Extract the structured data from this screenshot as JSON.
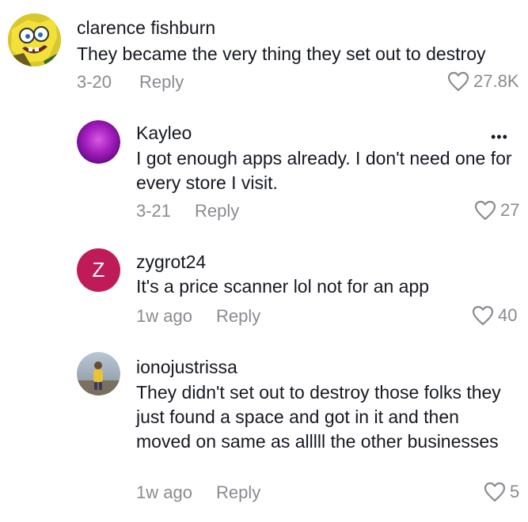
{
  "comments": [
    {
      "username": "clarence fishburn",
      "text": "They became the very thing they set out to destroy",
      "date": "3-20",
      "reply_label": "Reply",
      "likes": "27.8K",
      "avatar_icon": "spongebob-avatar"
    },
    {
      "username": "Kayleo",
      "text": "I got enough apps already. I don't need one for every store I visit.",
      "date": "3-21",
      "reply_label": "Reply",
      "likes": "27",
      "avatar_icon": "purple-gradient-avatar",
      "more_label": "•••"
    },
    {
      "username": "zygrot24",
      "text": "It's a price scanner lol not for an app",
      "date": "1w ago",
      "reply_label": "Reply",
      "likes": "40",
      "avatar_letter": "Z",
      "avatar_color": "#c01b59"
    },
    {
      "username": "ionojustrissa",
      "text": "They didn't set out to destroy those folks they just found a space and got in it and then moved on same as alllll the other businesses",
      "date": "1w ago",
      "reply_label": "Reply",
      "likes": "5",
      "avatar_icon": "person-photo-avatar"
    }
  ],
  "colors": {
    "text": "#161823",
    "muted": "#8a8b91",
    "avatar_z": "#c01b59"
  }
}
